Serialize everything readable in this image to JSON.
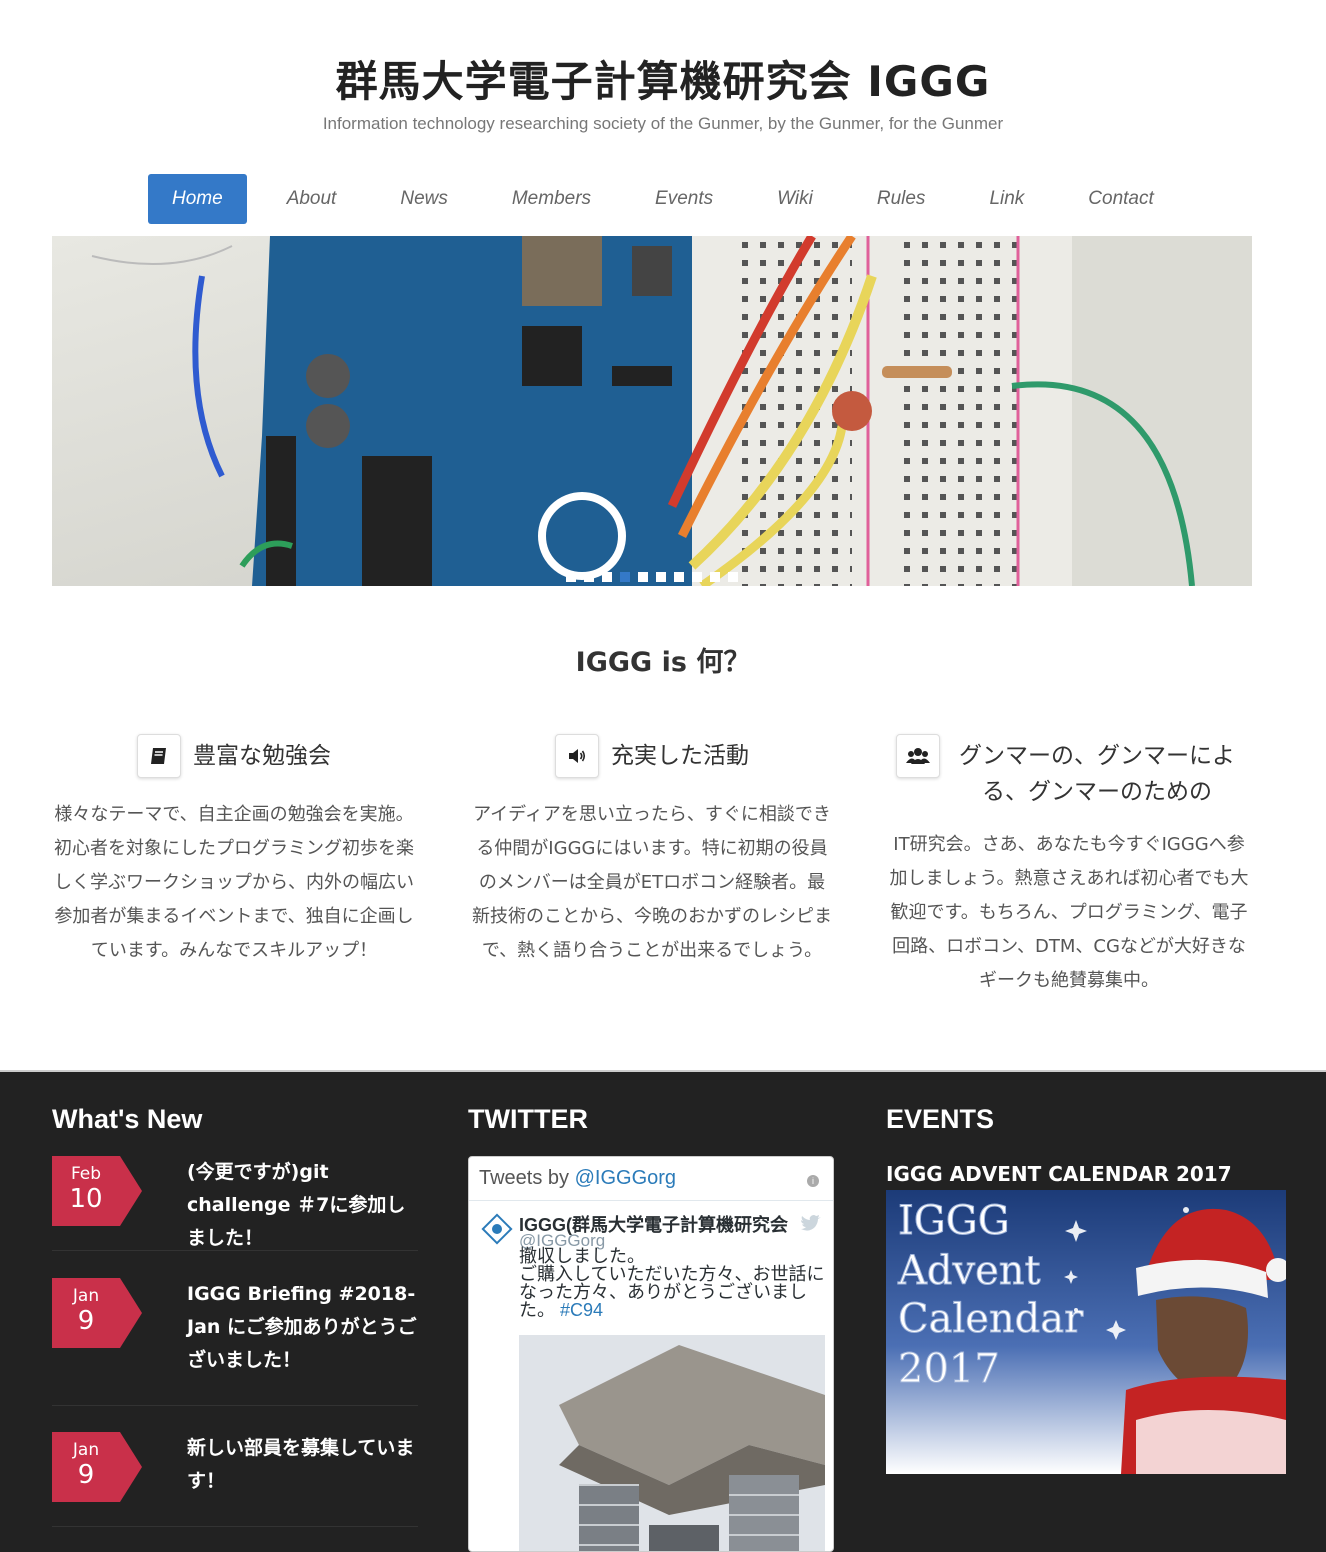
{
  "header": {
    "title": "群馬大学電子計算機研究会 IGGG",
    "tagline": "Information technology researching society of the Gunmer, by the Gunmer, for the Gunmer"
  },
  "nav": {
    "items": [
      {
        "label": "Home",
        "active": true
      },
      {
        "label": "About"
      },
      {
        "label": "News"
      },
      {
        "label": "Members"
      },
      {
        "label": "Events"
      },
      {
        "label": "Wiki"
      },
      {
        "label": "Rules"
      },
      {
        "label": "Link"
      },
      {
        "label": "Contact"
      }
    ],
    "accent": "#3479c8"
  },
  "slider": {
    "slide_count": 10,
    "active_index": 3
  },
  "about": {
    "title": "IGGG is 何？",
    "features": [
      {
        "icon": "book-icon",
        "title": "豊富な勉強会",
        "body": "様々なテーマで、自主企画の勉強会を実施。初心者を対象にしたプログラミング初歩を楽しく学ぶワークショップから、内外の幅広い参加者が集まるイベントまで、独自に企画しています。みんなでスキルアップ！"
      },
      {
        "icon": "speaker-icon",
        "title": "充実した活動",
        "body": "アイディアを思い立ったら、すぐに相談できる仲間がIGGGにはいます。特に初期の役員のメンバーは全員がETロボコン経験者。最新技術のことから、今晩のおかずのレシピまで、熱く語り合うことが出来るでしょう。"
      },
      {
        "icon": "users-icon",
        "title": "グンマーの、グンマーによる、グンマーのための",
        "body": "IT研究会。さあ、あなたも今すぐIGGGへ参加しましょう。熱意さえあれば初心者でも大歓迎です。もちろん、プログラミング、電子回路、ロボコン、DTM、CGなどが大好きなギークも絶賛募集中。"
      }
    ]
  },
  "footer": {
    "news_heading": "What's New",
    "twitter_heading": "TWITTER",
    "events_heading": "EVENTS",
    "news": [
      {
        "month": "Feb",
        "day": "10",
        "title": "(今更ですが)git challenge ＃7に参加しました！"
      },
      {
        "month": "Jan",
        "day": "9",
        "title": "IGGG Briefing #2018-Jan にご参加ありがとうございました！"
      },
      {
        "month": "Jan",
        "day": "9",
        "title": "新しい部員を募集しています！"
      }
    ],
    "badge_color": "#c9304a",
    "twitter": {
      "header_prefix": "Tweets by ",
      "header_handle": "@IGGGorg",
      "name": "IGGG(群馬大学電子計算機研究会",
      "handle": "@IGGGorg",
      "text": "撤収しました。\nご購入していただいた方々、お世話になった方々、ありがとうございました。",
      "hashtag": "#C94"
    },
    "event": {
      "title": "IGGG ADVENT CALENDAR 2017",
      "banner_lines": [
        "IGGG",
        "Advent",
        "Calendar",
        "2017"
      ]
    }
  }
}
